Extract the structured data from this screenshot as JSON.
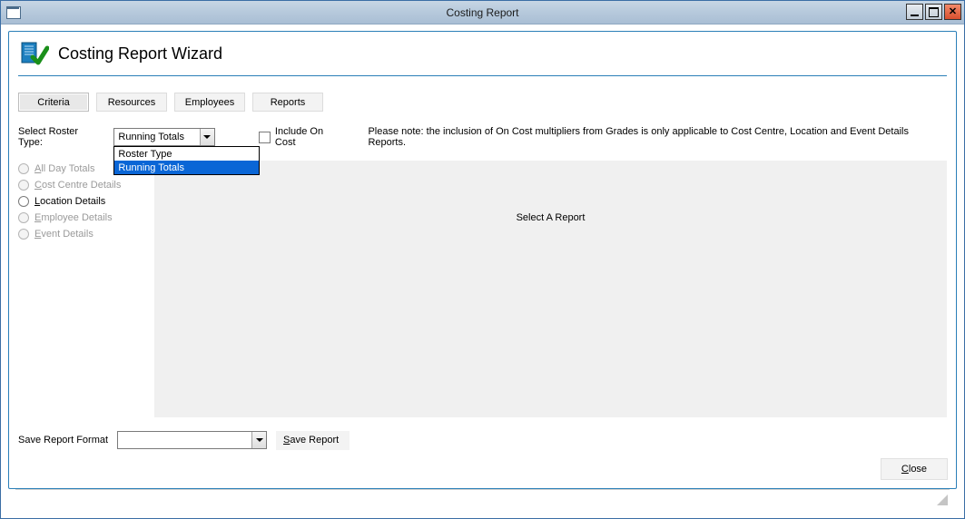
{
  "window": {
    "title": "Costing Report"
  },
  "wizard": {
    "title": "Costing Report Wizard"
  },
  "tabs": {
    "criteria": "Criteria",
    "resources": "Resources",
    "employees": "Employees",
    "reports": "Reports"
  },
  "criteria": {
    "roster_type_label": "Select Roster Type:",
    "roster_type_value": "Running Totals",
    "roster_type_options": {
      "opt0": "Roster Type",
      "opt1": "Running Totals"
    },
    "include_on_cost_label": "Include On Cost",
    "note": "Please note: the inclusion of On Cost multipliers from Grades is only applicable to Cost Centre, Location and Event Details Reports."
  },
  "radios": {
    "all_day": "ll Day Totals",
    "all_day_u": "A",
    "cost_centre": "ost Centre Details",
    "cost_centre_u": "C",
    "location": "ocation Details",
    "location_u": "L",
    "employee": "mployee Details",
    "employee_u": "E",
    "event": "vent Details",
    "event_u": "E"
  },
  "report_panel": {
    "placeholder": "Select A Report"
  },
  "footer": {
    "save_format_label": "Save Report Format",
    "save_format_value": "",
    "save_report_u": "S",
    "save_report": "ave Report",
    "close_u": "C",
    "close": "lose"
  }
}
